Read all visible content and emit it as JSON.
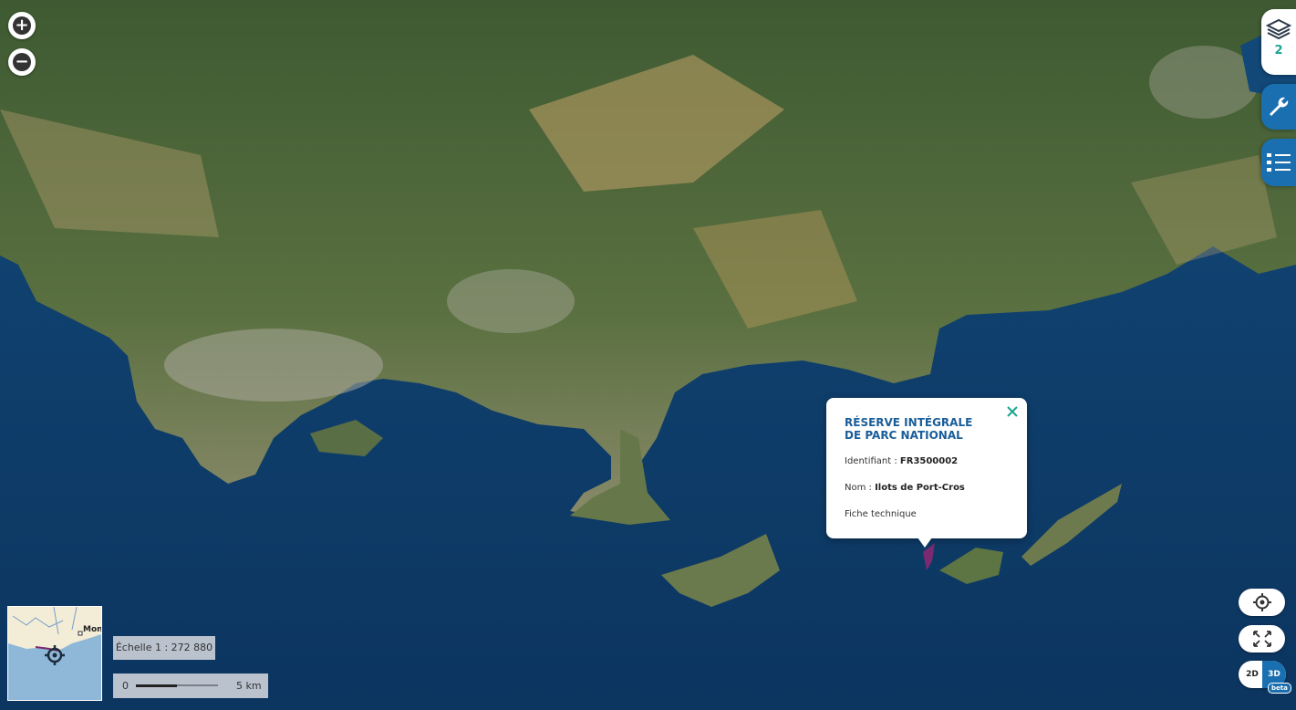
{
  "map": {
    "basemap": "satellite-imagery",
    "colors": {
      "sea": "#0f3a66",
      "land": "#4d6a3a",
      "highlight": "#7a2a6f",
      "accent": "#1a6fb0"
    }
  },
  "zoom": {
    "in_icon": "plus-icon",
    "out_icon": "minus-icon",
    "in_glyph": "+",
    "out_glyph": "−"
  },
  "side_panel": {
    "layers_count": "2",
    "icons": [
      "layers-icon",
      "wrench-icon",
      "legend-list-icon"
    ]
  },
  "popup": {
    "title": "RÉSERVE INTÉGRALE DE PARC NATIONAL",
    "id_label": "Identifiant : ",
    "id_value": "FR3500002",
    "name_label": "Nom : ",
    "name_value": "Ilots de Port-Cros",
    "link": "Fiche technique"
  },
  "minimap": {
    "label": "Mon"
  },
  "scale": {
    "text": "Échelle 1 : 272 880",
    "bar_start": "0",
    "bar_end": "5 km"
  },
  "view_toggle": {
    "option_2d": "2D",
    "option_3d": "3D",
    "selected": "3D",
    "badge": "beta"
  }
}
